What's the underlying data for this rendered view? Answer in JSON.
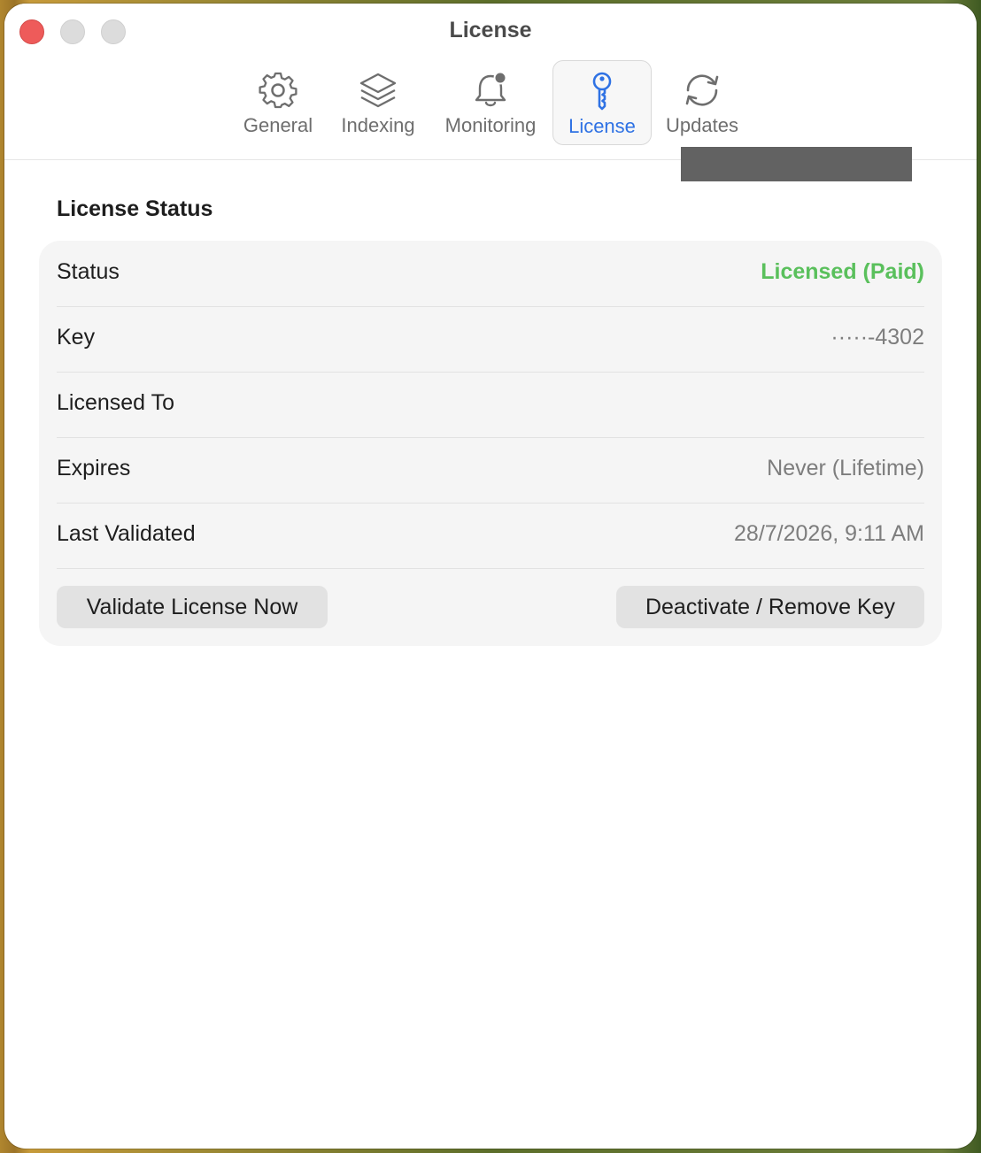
{
  "window": {
    "title": "License"
  },
  "toolbar": {
    "tabs": [
      {
        "label": "General",
        "icon": "gear-icon"
      },
      {
        "label": "Indexing",
        "icon": "layers-icon"
      },
      {
        "label": "Monitoring",
        "icon": "bell-badge-icon"
      },
      {
        "label": "License",
        "icon": "key-icon",
        "active": true
      },
      {
        "label": "Updates",
        "icon": "refresh-icon"
      }
    ]
  },
  "license_status": {
    "title": "License Status",
    "rows": [
      {
        "label": "Status",
        "value": "Licensed (Paid)"
      },
      {
        "label": "Key",
        "value": "·····-4302"
      },
      {
        "label": "Licensed To",
        "value": ""
      },
      {
        "label": "Expires",
        "value": "Never (Lifetime)"
      },
      {
        "label": "Last Validated",
        "value": "28/7/2026, 9:11 AM"
      }
    ],
    "validate_button": "Validate License Now",
    "deactivate_button": "Deactivate / Remove Key"
  },
  "colors": {
    "accent": "#2f72e4",
    "status_green": "#5ac05c",
    "close_red": "#ee5b5a"
  }
}
